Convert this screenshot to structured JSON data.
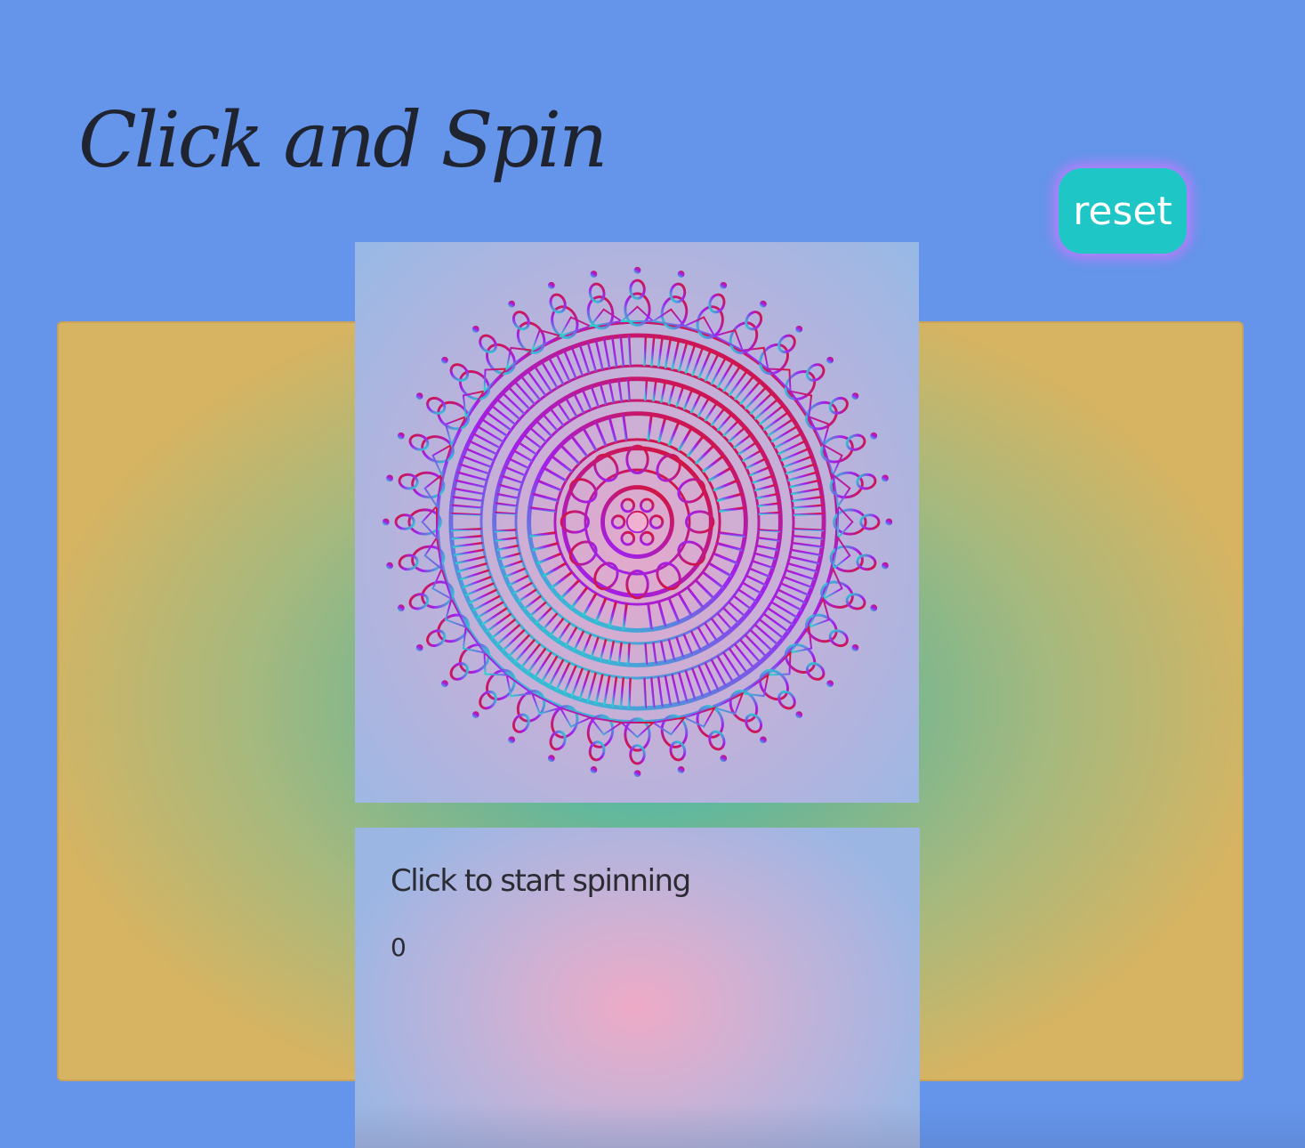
{
  "page": {
    "title": "Click and Spin",
    "background_color": "#6495ea"
  },
  "controls": {
    "reset_label": "reset",
    "reset_color": "#1ec7c6"
  },
  "mandala": {
    "icon": "mandala-icon",
    "colors": [
      "#d4143c",
      "#a020f0",
      "#2ad0d0",
      "#ffffff"
    ]
  },
  "info": {
    "status": "Click to start spinning",
    "count": "0"
  }
}
